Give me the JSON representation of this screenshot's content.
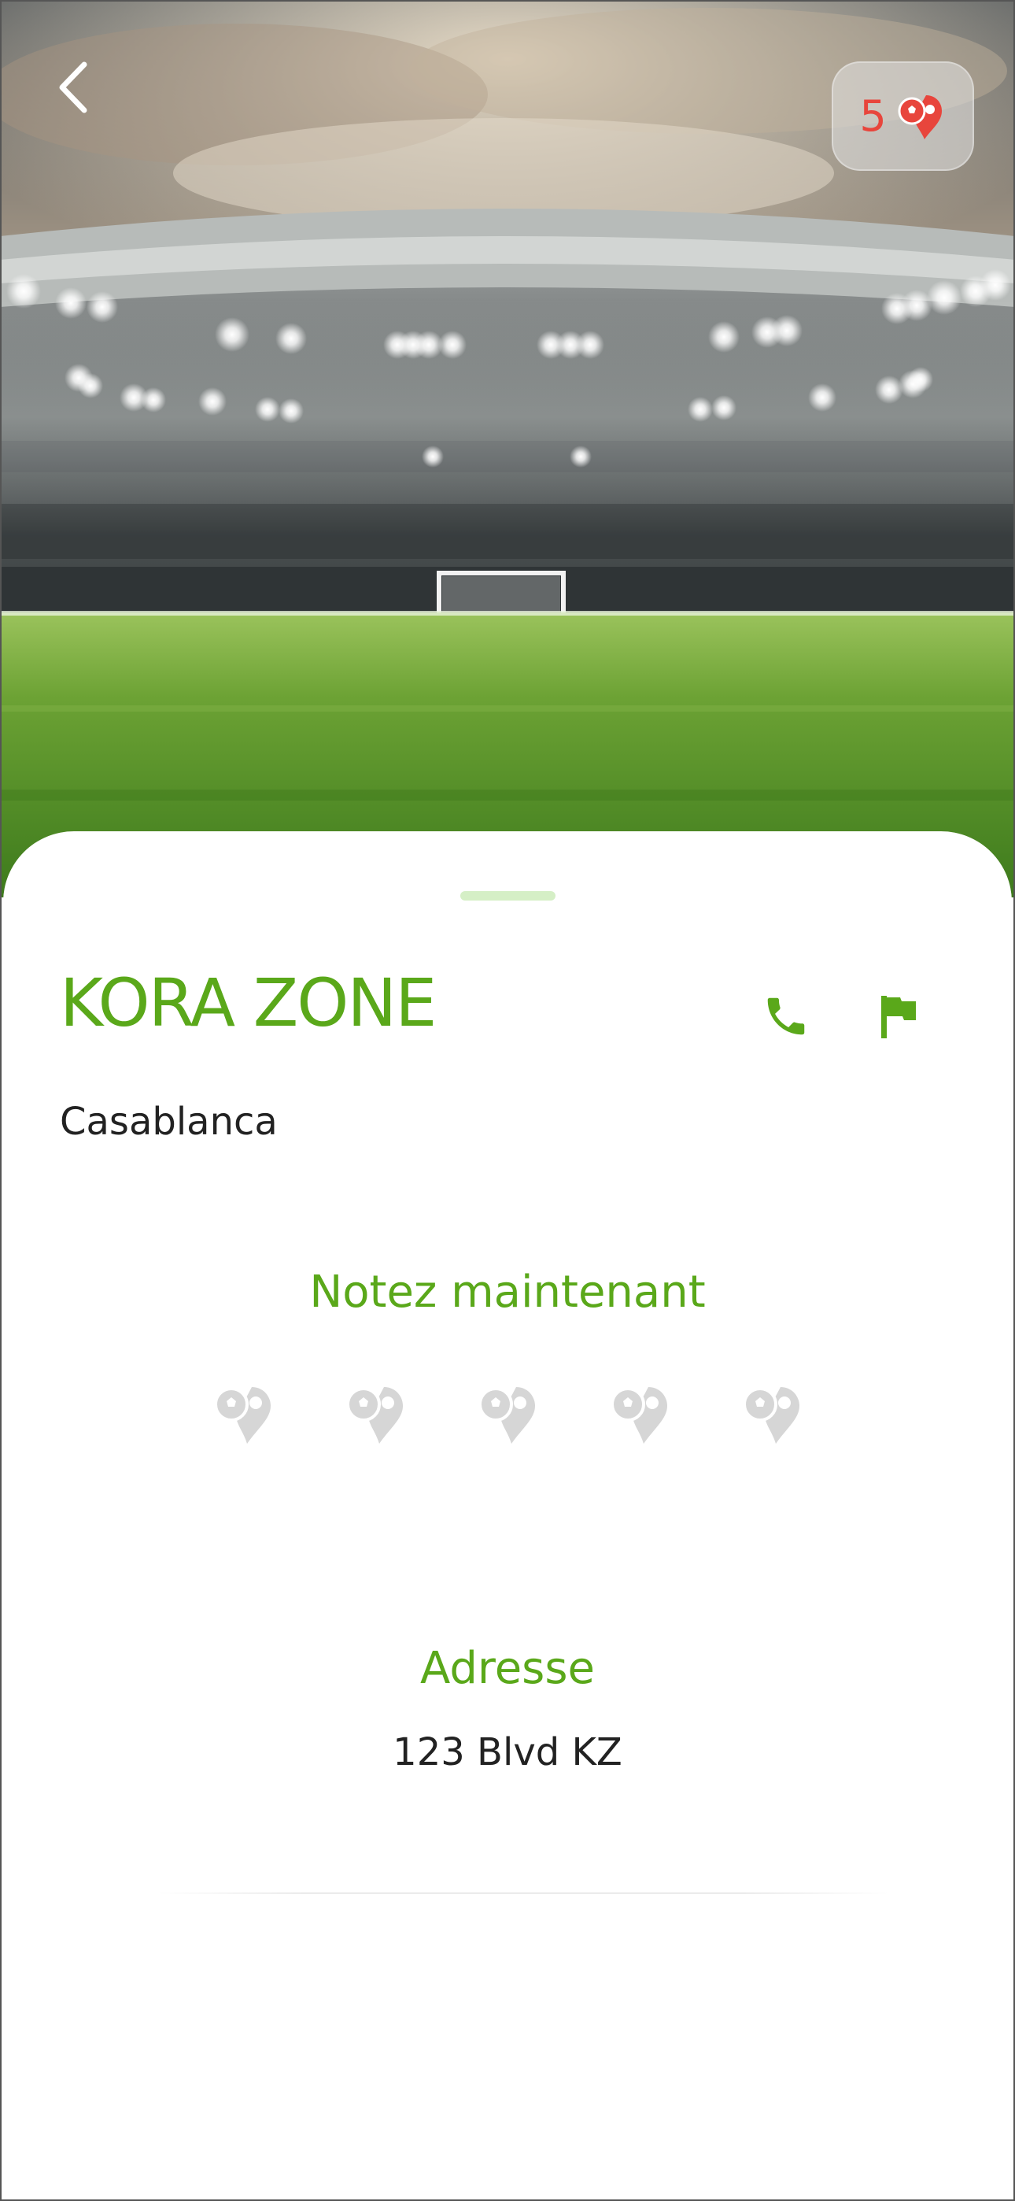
{
  "header": {
    "back_icon": "chevron-left-icon",
    "rating_count": "5",
    "rating_icon": "football-pin-icon"
  },
  "venue": {
    "name": "KORA ZONE",
    "city": "Casablanca",
    "actions": [
      {
        "icon": "phone-icon"
      },
      {
        "icon": "flag-icon"
      }
    ]
  },
  "rating": {
    "label": "Notez maintenant",
    "max": 5,
    "value": 0
  },
  "address": {
    "label": "Adresse",
    "value": "123 Blvd KZ"
  },
  "colors": {
    "accent": "#5aa81a",
    "badge_text": "#e8453c",
    "text": "#222222",
    "inactive_pin": "#d6d6d6"
  }
}
